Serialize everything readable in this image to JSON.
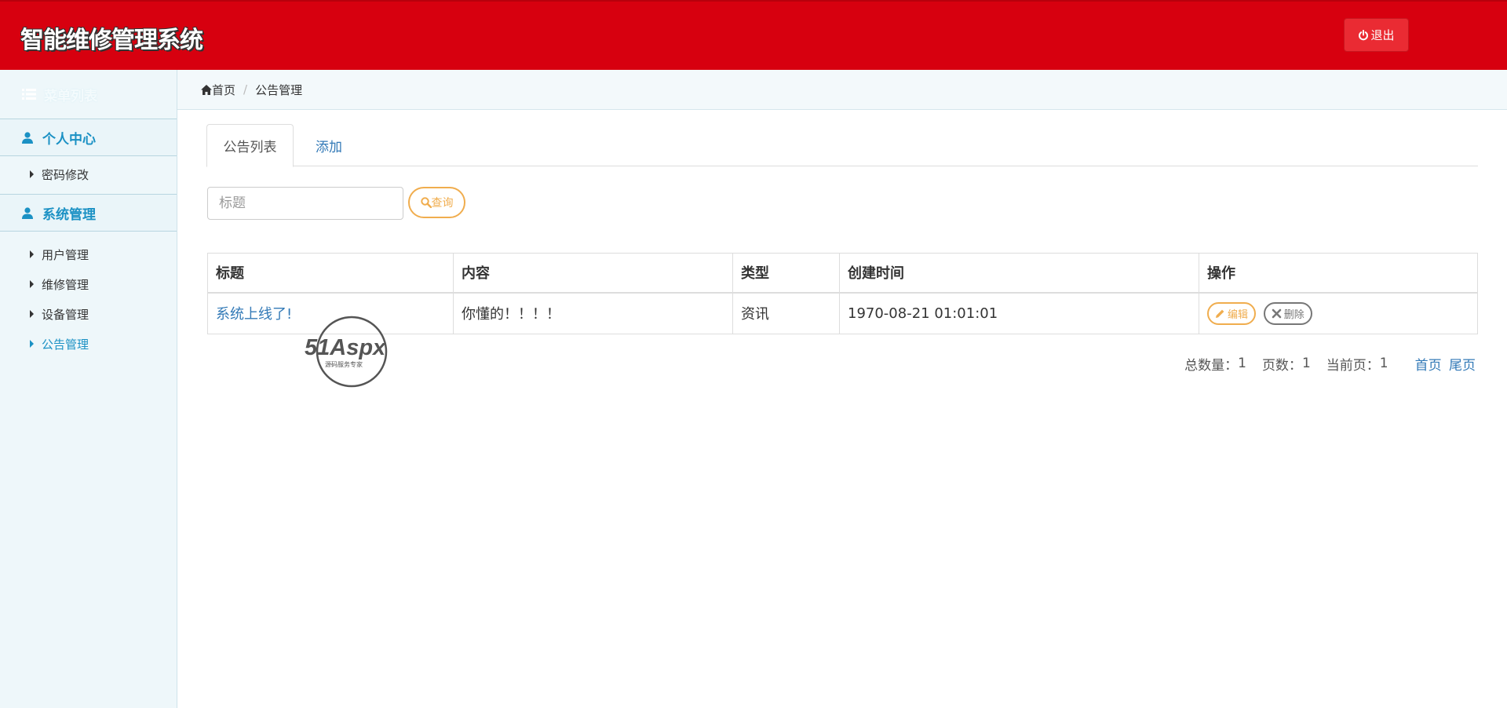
{
  "header": {
    "title": "智能维修管理系统",
    "logout_label": "退出"
  },
  "sidebar": {
    "menu_title": "菜单列表",
    "sections": [
      {
        "label": "个人中心",
        "items": [
          {
            "label": "密码修改"
          }
        ]
      },
      {
        "label": "系统管理",
        "items": [
          {
            "label": "用户管理"
          },
          {
            "label": "维修管理"
          },
          {
            "label": "设备管理"
          },
          {
            "label": "公告管理",
            "active": true
          }
        ]
      }
    ]
  },
  "breadcrumb": {
    "home": "首页",
    "current": "公告管理"
  },
  "tabs": [
    {
      "label": "公告列表",
      "active": true
    },
    {
      "label": "添加"
    }
  ],
  "search": {
    "placeholder": "标题",
    "button_label": "查询"
  },
  "table": {
    "headers": [
      "标题",
      "内容",
      "类型",
      "创建时间",
      "操作"
    ],
    "rows": [
      {
        "title": "系统上线了!",
        "content": "你懂的！！！！",
        "type": "资讯",
        "created": "1970-08-21 01:01:01",
        "edit_label": "编辑",
        "delete_label": "删除"
      }
    ]
  },
  "pager": {
    "total_label": "总数量：",
    "total": "1",
    "pages_label": "页数：",
    "pages": "1",
    "current_label": "当前页：",
    "current": "1",
    "first": "首页",
    "last": "尾页"
  },
  "watermark": {
    "brand": "51Aspx",
    "tagline": "源码服务专家"
  },
  "colors": {
    "header_bg": "#d7000f",
    "accent": "#1b91c4",
    "warning": "#f0ad4e",
    "link": "#337ab7"
  }
}
